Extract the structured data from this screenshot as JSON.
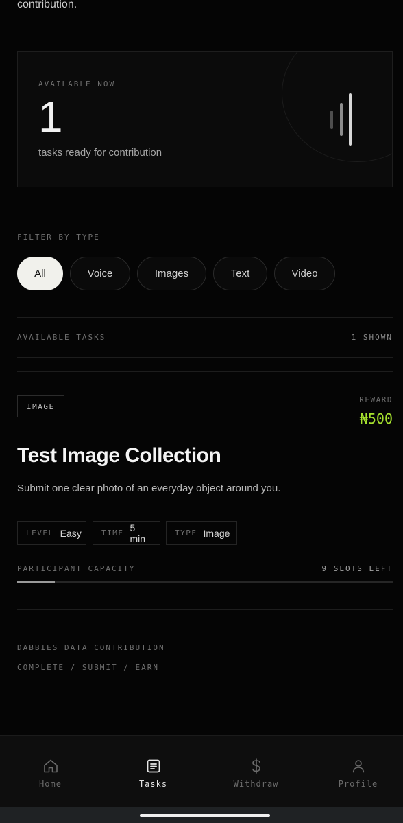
{
  "intro": {
    "tail_text": "contribution."
  },
  "hero": {
    "kicker": "AVAILABLE NOW",
    "count": "1",
    "subtitle": "tasks ready for contribution"
  },
  "filter": {
    "label": "FILTER BY TYPE",
    "chips": [
      "All",
      "Voice",
      "Images",
      "Text",
      "Video"
    ],
    "selected": "All"
  },
  "tasks_header": {
    "label": "AVAILABLE TASKS",
    "count_text": "1 SHOWN"
  },
  "task": {
    "type_badge": "IMAGE",
    "reward_label": "REWARD",
    "reward_value": "₦500",
    "title": "Test Image Collection",
    "description": "Submit one clear photo of an everyday object around you.",
    "meta": [
      {
        "key": "LEVEL",
        "value": "Easy"
      },
      {
        "key": "TIME",
        "value": "5 min"
      },
      {
        "key": "TYPE",
        "value": "Image"
      }
    ],
    "capacity_label": "PARTICIPANT CAPACITY",
    "capacity_text": "9 SLOTS LEFT",
    "capacity_fraction": 0.1
  },
  "footer": {
    "line1": "DABBIES DATA CONTRIBUTION",
    "line2": "COMPLETE / SUBMIT / EARN"
  },
  "nav": {
    "items": [
      {
        "label": "Home",
        "icon": "home-icon"
      },
      {
        "label": "Tasks",
        "icon": "tasks-icon"
      },
      {
        "label": "Withdraw",
        "icon": "dollar-icon"
      },
      {
        "label": "Profile",
        "icon": "profile-icon"
      }
    ],
    "active": "Tasks"
  },
  "colors": {
    "background": "#050505",
    "accent_reward": "#a6e22e",
    "chip_active_bg": "#f1f1ec"
  }
}
